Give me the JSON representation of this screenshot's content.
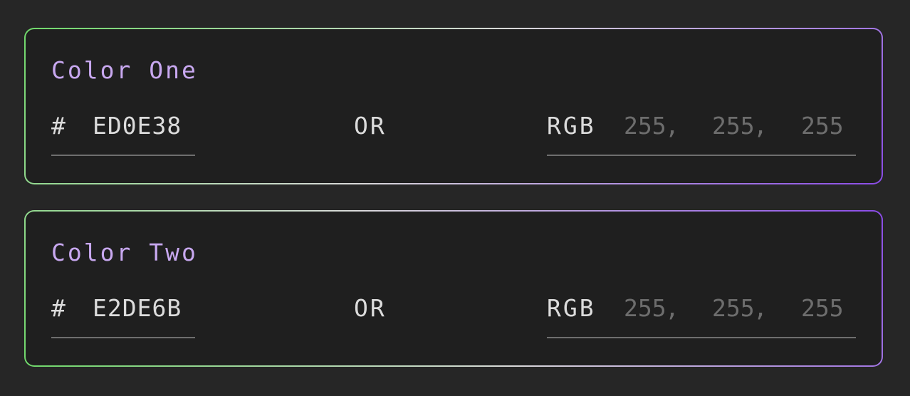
{
  "colors": [
    {
      "title": "Color One",
      "hash_symbol": "#",
      "hex_value": "ED0E38",
      "or_label": "OR",
      "rgb_label": "RGB",
      "rgb_placeholders": [
        "255",
        "255",
        "255"
      ],
      "rgb_separator": ","
    },
    {
      "title": "Color Two",
      "hash_symbol": "#",
      "hex_value": "E2DE6B",
      "or_label": "OR",
      "rgb_label": "RGB",
      "rgb_placeholders": [
        "255",
        "255",
        "255"
      ],
      "rgb_separator": ","
    }
  ],
  "theme": {
    "background": "#262626",
    "card_background": "#1f1f1f",
    "title_color": "#c8a8f0",
    "text_color": "#dcdcdc",
    "placeholder_color": "#6d6d6d",
    "underline_color": "#6e6e6e",
    "border_gradient": [
      "#6fd86a",
      "#d9d9d9",
      "#8a4be6"
    ]
  }
}
